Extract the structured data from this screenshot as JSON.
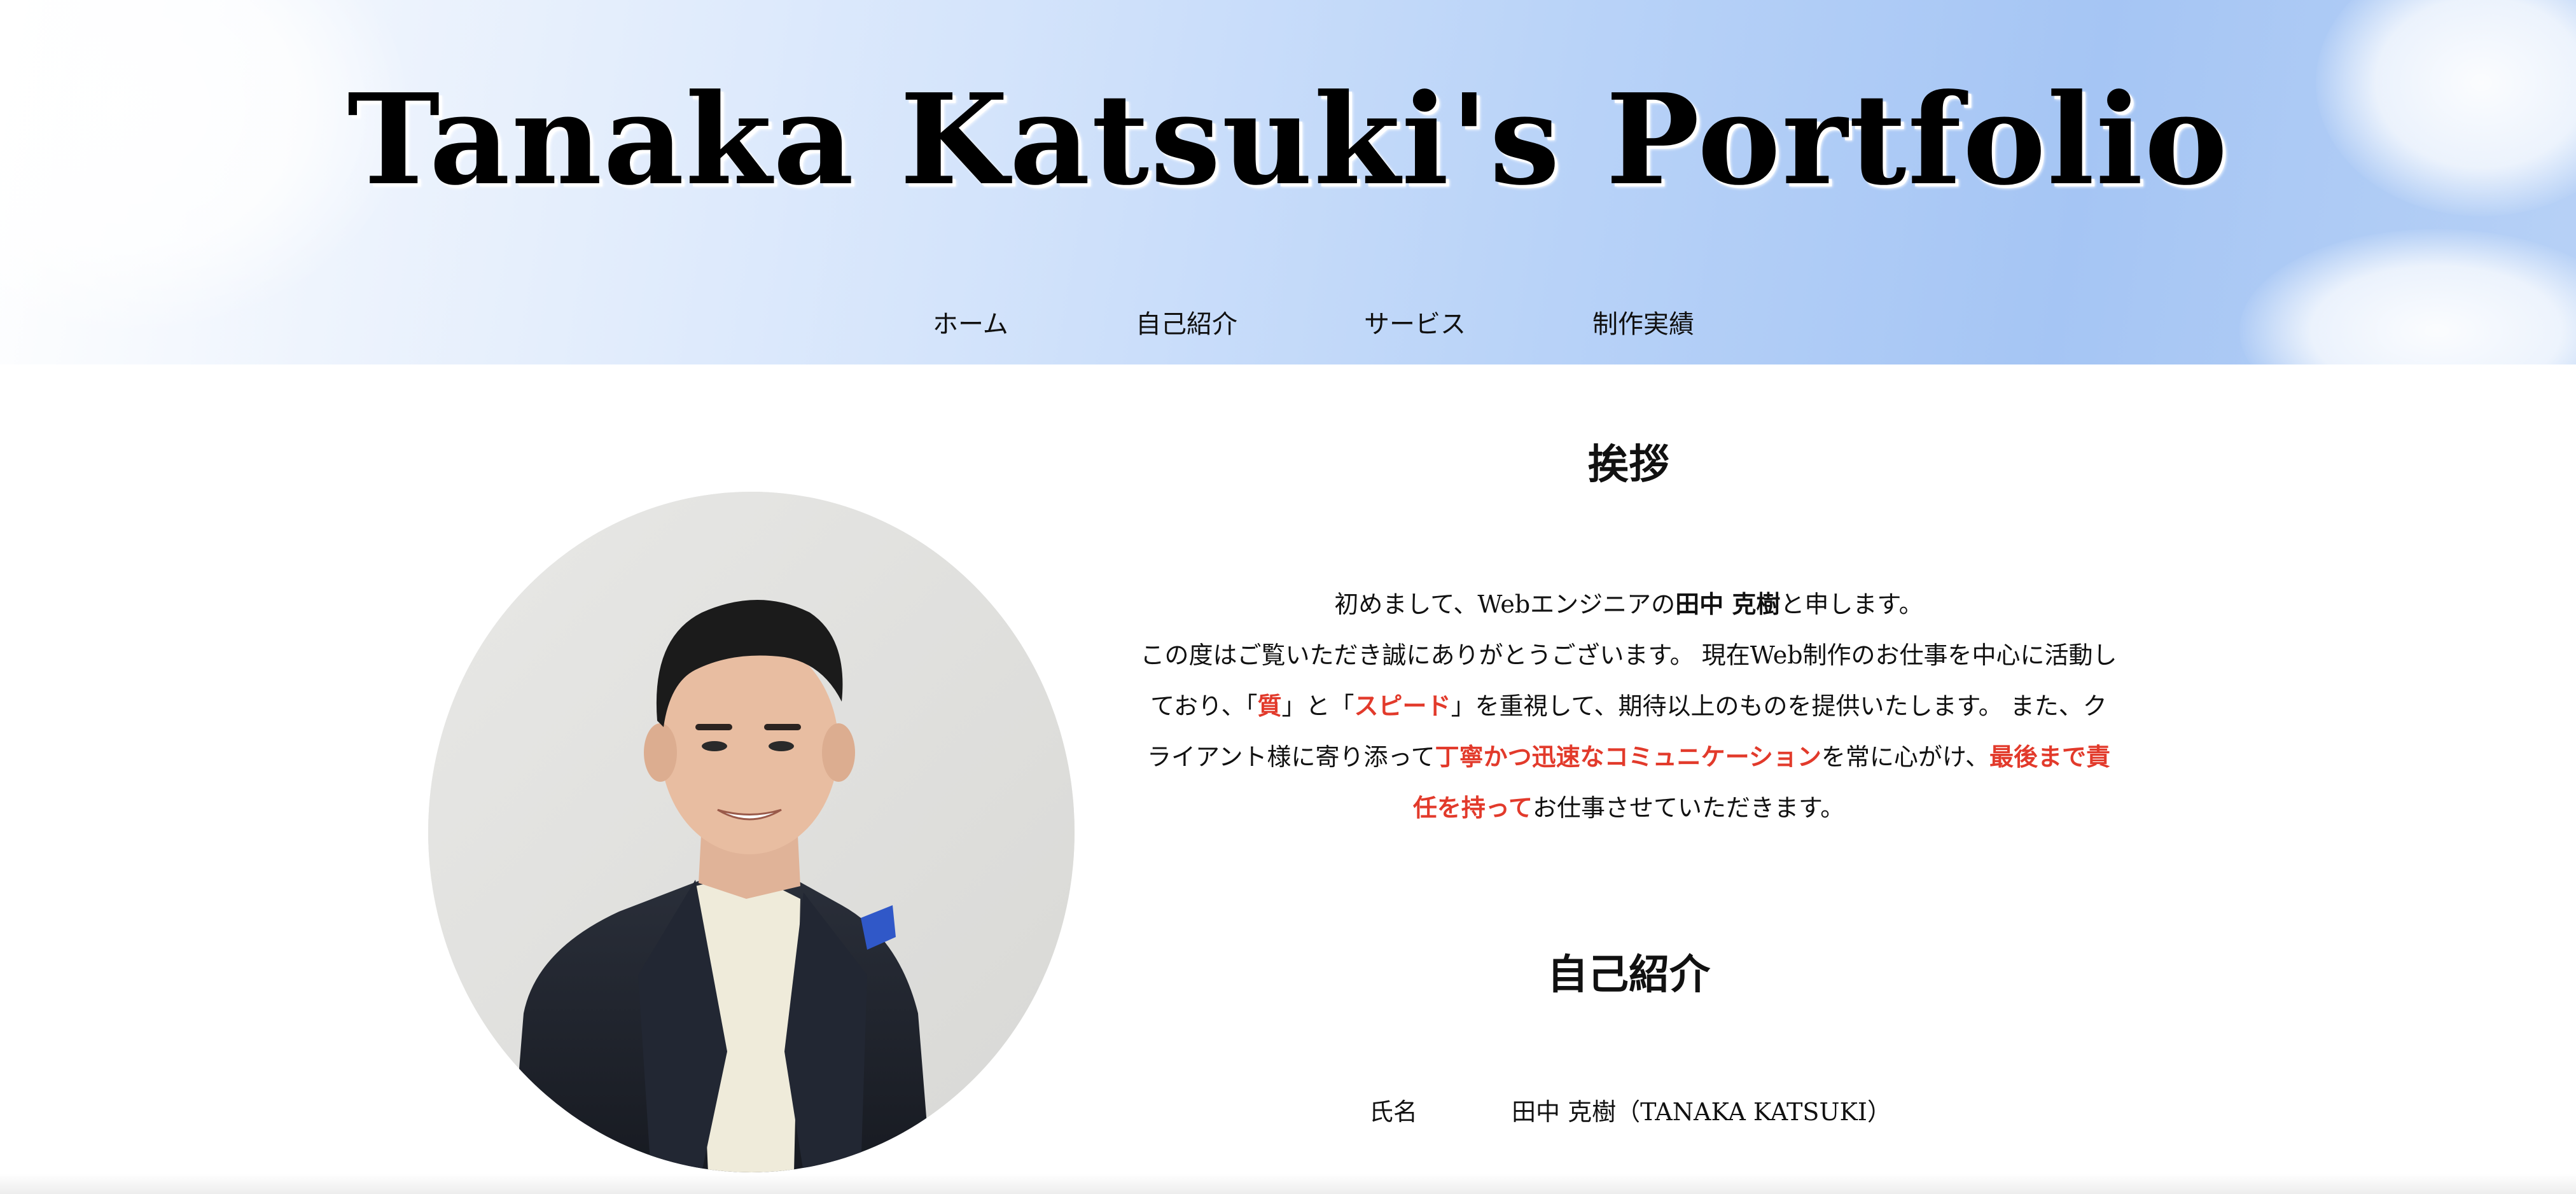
{
  "header": {
    "title": "Tanaka Katsuki's Portfolio",
    "nav": [
      {
        "label": "ホーム"
      },
      {
        "label": "自己紹介"
      },
      {
        "label": "サービス"
      },
      {
        "label": "制作実績"
      }
    ]
  },
  "greeting": {
    "heading": "挨拶",
    "line1_prefix": "初めまして、Webエンジニアの",
    "line1_name": "田中 克樹",
    "line1_suffix": "と申します。",
    "line2": "この度はご覧いただき誠にありがとうございます。 現在Web制作のお仕事を中心に活動し",
    "line3_a": "ており、「",
    "line3_quality": "質",
    "line3_b": "」と「",
    "line3_speed": "スピード",
    "line3_c": "」を重視して、期待以上のものを提供いたします。 また、ク",
    "line4_a": "ライアント様に寄り添って",
    "line4_em1": "丁寧かつ迅速なコミュニケーション",
    "line4_b": "を常に心がけ、",
    "line4_em2": "最後まで責",
    "line5_em": "任を持って",
    "line5_b": "お仕事させていただきます。"
  },
  "profile": {
    "heading": "自己紹介",
    "name_label": "氏名",
    "name_value": "田中 克樹（TANAKA KATSUKI）"
  },
  "colors": {
    "accent": "#e23a2b",
    "sky_light": "#d4e4fb",
    "sky_deep": "#a5c5f4",
    "text": "#111111"
  }
}
